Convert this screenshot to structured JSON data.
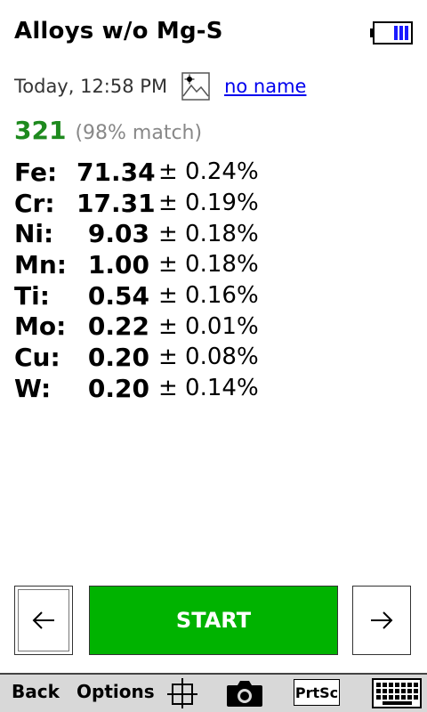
{
  "header": {
    "title": "Alloys w/o Mg-S",
    "battery_icon": "battery-icon"
  },
  "reading": {
    "timestamp": "Today, 12:58 PM",
    "photo_icon": "image-icon",
    "name_link": "no name",
    "grade": "321",
    "match": "(98% match)"
  },
  "results": [
    {
      "element": "Fe:",
      "value": "71.34",
      "error": "± 0.24%"
    },
    {
      "element": "Cr:",
      "value": "17.31",
      "error": "± 0.19%"
    },
    {
      "element": "Ni:",
      "value": "9.03",
      "error": "± 0.18%"
    },
    {
      "element": "Mn:",
      "value": "1.00",
      "error": "± 0.18%"
    },
    {
      "element": "Ti:",
      "value": "0.54",
      "error": "± 0.16%"
    },
    {
      "element": "Mo:",
      "value": "0.22",
      "error": "± 0.01%"
    },
    {
      "element": "Cu:",
      "value": "0.20",
      "error": "± 0.08%"
    },
    {
      "element": "W:",
      "value": "0.20",
      "error": "± 0.14%"
    }
  ],
  "controls": {
    "prev_icon": "←",
    "start_label": "START",
    "next_icon": "→"
  },
  "toolbar": {
    "back_label": "Back",
    "options_label": "Options",
    "crosshair_icon": "crosshair-icon",
    "camera_icon": "camera-icon",
    "prtsc_label": "PrtSc",
    "keyboard_icon": "keyboard-icon"
  },
  "colors": {
    "start_green": "#00b300",
    "grade_green": "#1e8a1e",
    "link_blue": "#0000ee",
    "battery_blue": "#1a1aff"
  }
}
